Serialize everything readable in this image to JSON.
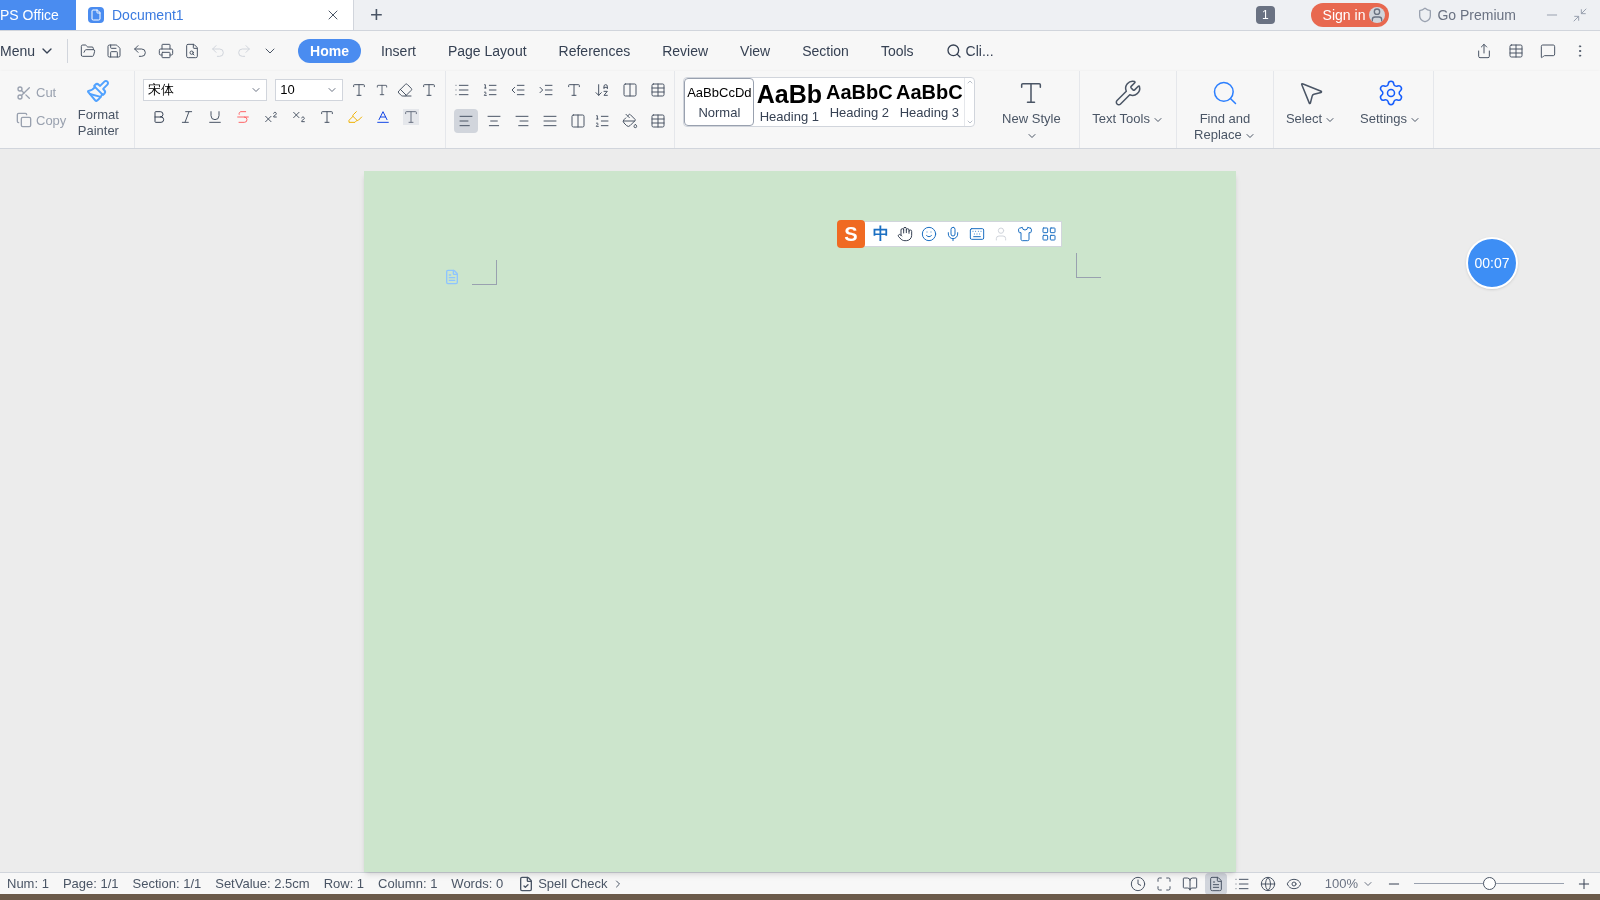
{
  "title_bar": {
    "app_tab": "PS Office",
    "doc_tab": {
      "title": "Document1",
      "selected": true
    },
    "new_tab": "+",
    "badge": "1",
    "sign_in": "Sign in",
    "go_premium": "Go Premium"
  },
  "menu_bar": {
    "menu": "Menu",
    "tabs": [
      {
        "label": "Home",
        "selected": true
      },
      {
        "label": "Insert",
        "selected": false
      },
      {
        "label": "Page Layout",
        "selected": false
      },
      {
        "label": "References",
        "selected": false
      },
      {
        "label": "Review",
        "selected": false
      },
      {
        "label": "View",
        "selected": false
      },
      {
        "label": "Section",
        "selected": false
      },
      {
        "label": "Tools",
        "selected": false
      }
    ],
    "search": "Cli..."
  },
  "ribbon": {
    "clipboard": {
      "cut": "Cut",
      "copy": "Copy",
      "format_painter": "Format Painter"
    },
    "font": {
      "name": "宋体",
      "size": "10"
    },
    "alignments": [
      {
        "kind": "left",
        "selected": true
      },
      {
        "kind": "center",
        "selected": false
      },
      {
        "kind": "right",
        "selected": false
      },
      {
        "kind": "justify",
        "selected": false
      },
      {
        "kind": "distributed",
        "selected": false
      }
    ],
    "styles": [
      {
        "kind": "normal",
        "preview": "AaBbCcDd",
        "name": "Normal",
        "selected": true
      },
      {
        "kind": "heading1",
        "preview": "AaBb",
        "name": "Heading 1",
        "selected": false
      },
      {
        "kind": "heading2",
        "preview": "AaBbC",
        "name": "Heading 2",
        "selected": false
      },
      {
        "kind": "heading3",
        "preview": "AaBbC",
        "name": "Heading 3",
        "selected": false
      }
    ],
    "tools": [
      {
        "kind": "new_style",
        "label": "New Style"
      },
      {
        "kind": "text_tools",
        "label": "Text Tools"
      },
      {
        "kind": "find_replace",
        "label": "Find and Replace"
      },
      {
        "kind": "select",
        "label": "Select"
      },
      {
        "kind": "settings",
        "label": "Settings"
      }
    ]
  },
  "ime_toolbar": {
    "logo": "S",
    "mode": "中"
  },
  "timer": "00:07",
  "status_bar": {
    "items": [
      "Num: 1",
      "Page: 1/1",
      "Section: 1/1",
      "SetValue: 2.5cm",
      "Row: 1",
      "Column: 1",
      "Words: 0"
    ],
    "spell_check": "Spell Check",
    "views": [
      {
        "kind": "reading",
        "selected": false
      },
      {
        "kind": "fullscreen",
        "selected": false
      },
      {
        "kind": "book",
        "selected": false
      },
      {
        "kind": "page",
        "selected": true
      },
      {
        "kind": "outline",
        "selected": false
      },
      {
        "kind": "web",
        "selected": false
      },
      {
        "kind": "eye",
        "selected": false
      }
    ],
    "zoom": {
      "reading": "100%",
      "level": 0.5
    }
  }
}
